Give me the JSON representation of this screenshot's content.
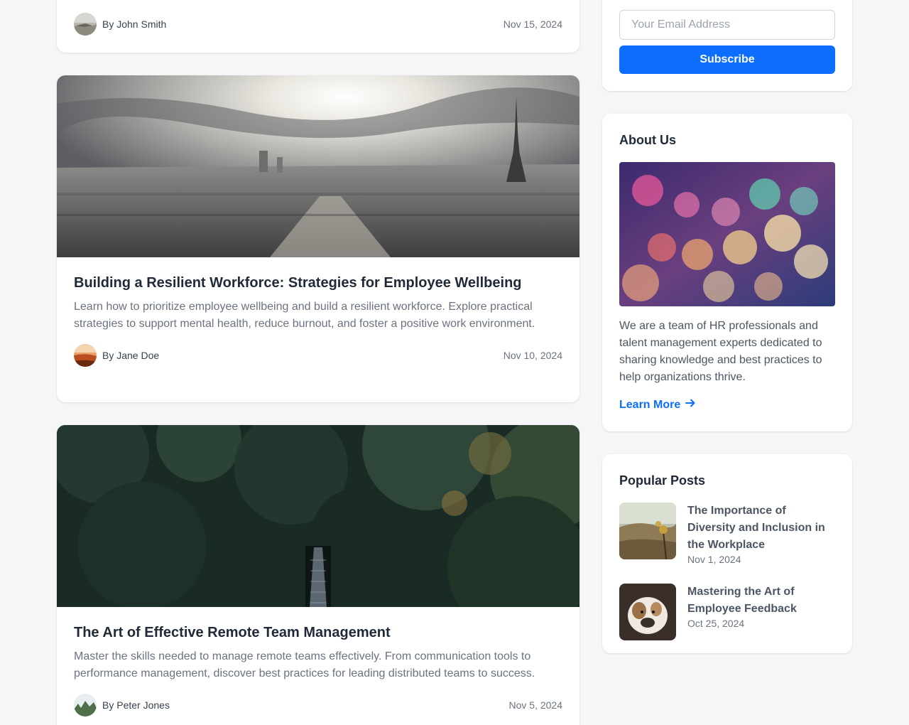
{
  "posts": [
    {
      "author": "By John Smith",
      "date": "Nov 15, 2024"
    },
    {
      "title": "Building a Resilient Workforce: Strategies for Employee Wellbeing",
      "excerpt": "Learn how to prioritize employee wellbeing and build a resilient workforce. Explore practical strategies to support mental health, reduce burnout, and foster a positive work environment.",
      "author": "By Jane Doe",
      "date": "Nov 10, 2024"
    },
    {
      "title": "The Art of Effective Remote Team Management",
      "excerpt": "Master the skills needed to manage remote teams effectively. From communication tools to performance management, discover best practices for leading distributed teams to success.",
      "author": "By Peter Jones",
      "date": "Nov 5, 2024"
    }
  ],
  "newsletter": {
    "email_placeholder": "Your Email Address",
    "subscribe_label": "Subscribe"
  },
  "about": {
    "title": "About Us",
    "text": "We are a team of HR professionals and talent management experts dedicated to sharing knowledge and best practices to help organizations thrive.",
    "learn_more_label": "Learn More",
    "learn_more_icon": "arrow-right-icon"
  },
  "popular": {
    "title": "Popular Posts",
    "items": [
      {
        "title": "The Importance of Diversity and Inclusion in the Workplace",
        "date": "Nov 1, 2024"
      },
      {
        "title": "Mastering the Art of Employee Feedback",
        "date": "Oct 25, 2024"
      }
    ]
  },
  "colors": {
    "accent": "#0d6efd",
    "background": "#f5f6f8",
    "card": "#ffffff"
  }
}
